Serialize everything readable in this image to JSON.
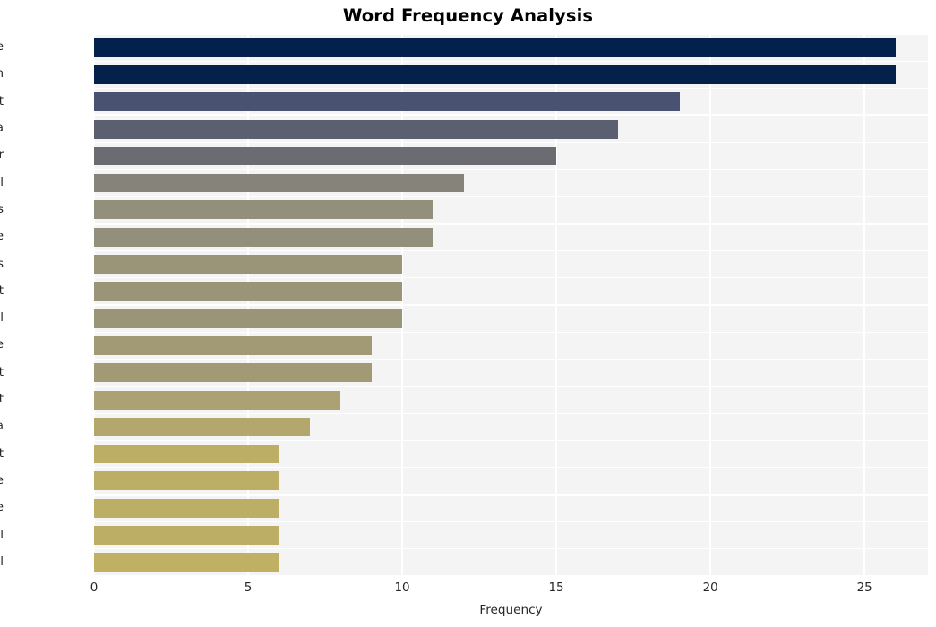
{
  "chart_data": {
    "type": "bar",
    "orientation": "horizontal",
    "title": "Word Frequency Analysis",
    "xlabel": "Frequency",
    "ylabel": "",
    "xlim": [
      0,
      27.06
    ],
    "xticks": [
      0,
      5,
      10,
      15,
      20,
      25
    ],
    "xtick_labels": [
      "0",
      "5",
      "10",
      "15",
      "20",
      "25"
    ],
    "grid": true,
    "legend": false,
    "categories": [
      "state",
      "terrorism",
      "list",
      "cuba",
      "sponsor",
      "international",
      "ucms",
      "unite",
      "countries",
      "support",
      "israel",
      "include",
      "terrorist",
      "act",
      "africa",
      "right",
      "article",
      "people",
      "council",
      "national"
    ],
    "values": [
      26,
      26,
      19,
      17,
      15,
      12,
      11,
      11,
      10,
      10,
      10,
      9,
      9,
      8,
      7,
      6,
      6,
      6,
      6,
      6
    ],
    "bar_colors": [
      "#04214c",
      "#04214c",
      "#4a5272",
      "#5a6070",
      "#6b6c72",
      "#86837b",
      "#92907c",
      "#92907c",
      "#9a9478",
      "#9a9478",
      "#9a9478",
      "#a29a75",
      "#a29a75",
      "#aba172",
      "#b3a76d",
      "#bdae66",
      "#bdae66",
      "#bdae66",
      "#bdae66",
      "#bfb063"
    ],
    "plot_background": "#f4f4f5",
    "grid_color": "#ffffff",
    "figure_background": "#ffffff",
    "text_color": "#262626"
  }
}
